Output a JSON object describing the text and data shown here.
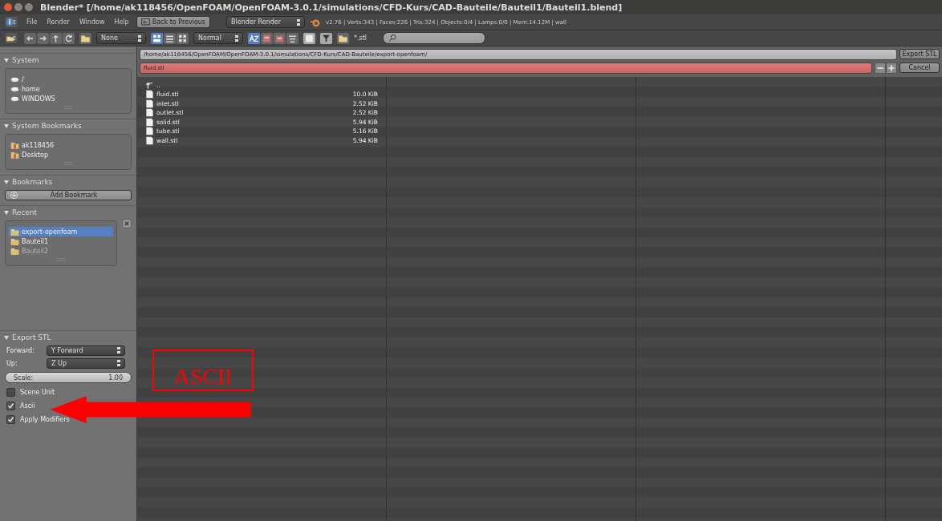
{
  "window": {
    "title": "Blender* [/home/ak118456/OpenFOAM/OpenFOAM-3.0.1/simulations/CFD-Kurs/CAD-Bauteile/Bauteil1/Bauteil1.blend]"
  },
  "menu_bar": {
    "menus": [
      "File",
      "Render",
      "Window",
      "Help"
    ],
    "back_button": "Back to Previous",
    "render_engine": "Blender Render",
    "stats": "v2.76 | Verts:343 | Faces:226 | Tris:324 | Objects:0/4 | Lamps:0/0 | Mem:14.12M | wall"
  },
  "toolbar": {
    "recursion": "None",
    "display_modes": [
      {
        "selected": true
      },
      {
        "selected": false
      },
      {
        "selected": false
      }
    ],
    "thumbnail_size": "Normal",
    "sort_modes": [
      {
        "selected": true
      },
      {
        "selected": false
      },
      {
        "selected": false
      },
      {
        "selected": false
      }
    ],
    "filter_glob": "*.stl"
  },
  "sidebar": {
    "panels": [
      {
        "title": "System",
        "kind": "drives",
        "items": [
          {
            "label": "/",
            "selected": false,
            "disabled": false
          },
          {
            "label": "home",
            "selected": false,
            "disabled": false
          },
          {
            "label": "WINDOWS",
            "selected": false,
            "disabled": false
          }
        ]
      },
      {
        "title": "System Bookmarks",
        "kind": "folders",
        "items": [
          {
            "label": "ak118456",
            "selected": false,
            "disabled": false
          },
          {
            "label": "Desktop",
            "selected": false,
            "disabled": false
          }
        ]
      },
      {
        "title": "Bookmarks",
        "kind": "button",
        "button": "Add Bookmark"
      },
      {
        "title": "Recent",
        "kind": "recent",
        "items": [
          {
            "label": "export-openfoam",
            "selected": true,
            "disabled": false
          },
          {
            "label": "Bauteil1",
            "selected": false,
            "disabled": false
          },
          {
            "label": "Bauteil2",
            "selected": false,
            "disabled": true
          }
        ]
      }
    ]
  },
  "export_options": {
    "title": "Export STL",
    "forward": {
      "label": "Forward:",
      "value": "Y Forward"
    },
    "up": {
      "label": "Up:",
      "value": "Z Up"
    },
    "scale": {
      "label": "Scale:",
      "value": "1.00"
    },
    "checkboxes": [
      {
        "label": "Scene Unit",
        "checked": false
      },
      {
        "label": "Ascii",
        "checked": true
      },
      {
        "label": "Apply Modifiers",
        "checked": true
      }
    ]
  },
  "file_browser": {
    "directory": "/home/ak118456/OpenFOAM/OpenFOAM-3.0.1/simulations/CFD-Kurs/CAD-Bauteile/export-openfoam/",
    "filename": "fluid.stl",
    "confirm_button": "Export STL",
    "cancel_button": "Cancel",
    "parent_entry": "..",
    "files": [
      {
        "name": "fluid.stl",
        "size": "10.0 KiB"
      },
      {
        "name": "inlet.stl",
        "size": "2.52 KiB"
      },
      {
        "name": "outlet.stl",
        "size": "2.52 KiB"
      },
      {
        "name": "solid.stl",
        "size": "5.94 KiB"
      },
      {
        "name": "tube.stl",
        "size": "5.16 KiB"
      },
      {
        "name": "wall.stl",
        "size": "5.94 KiB"
      }
    ]
  },
  "annotation": {
    "label": "ASCII"
  }
}
